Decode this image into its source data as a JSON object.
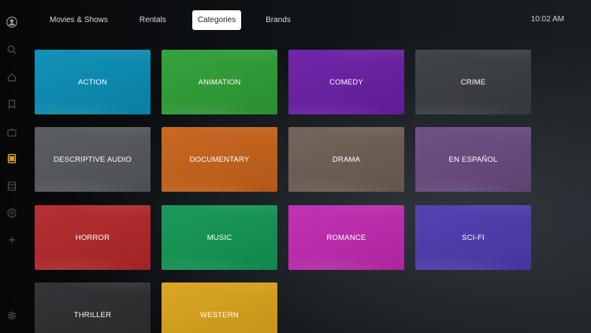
{
  "nav": {
    "tabs": [
      {
        "label": "Movies & Shows"
      },
      {
        "label": "Rentals"
      },
      {
        "label": "Categories",
        "active": true
      },
      {
        "label": "Brands"
      }
    ],
    "clock": "10:02 AM"
  },
  "sidebar": {
    "icons": [
      {
        "name": "profile-icon"
      },
      {
        "name": "search-icon"
      },
      {
        "name": "home-icon"
      },
      {
        "name": "bookmark-icon"
      },
      {
        "name": "tv-icon"
      },
      {
        "name": "movies-icon",
        "active": true
      },
      {
        "name": "film-icon"
      },
      {
        "name": "rentals-icon"
      },
      {
        "name": "add-icon"
      },
      {
        "name": "settings-icon"
      }
    ]
  },
  "categories": [
    {
      "label": "ACTION",
      "color": "#0a8db5"
    },
    {
      "label": "ANIMATION",
      "color": "#2f9f35"
    },
    {
      "label": "COMEDY",
      "color": "#6a1fa6"
    },
    {
      "label": "CRIME",
      "color": "#3a3d43"
    },
    {
      "label": "DESCRIPTIVE AUDIO",
      "color": "#55585d"
    },
    {
      "label": "DOCUMENTARY",
      "color": "#c7631a"
    },
    {
      "label": "DRAMA",
      "color": "#6d5f55"
    },
    {
      "label": "EN ESPAÑOL",
      "color": "#6a4a80"
    },
    {
      "label": "HORROR",
      "color": "#b3282a"
    },
    {
      "label": "MUSIC",
      "color": "#129655"
    },
    {
      "label": "ROMANCE",
      "color": "#c02ab0"
    },
    {
      "label": "SCI-FI",
      "color": "#4d3cb0"
    },
    {
      "label": "THRILLER",
      "color": "#2c2d30"
    },
    {
      "label": "WESTERN",
      "color": "#d9a31a"
    }
  ]
}
